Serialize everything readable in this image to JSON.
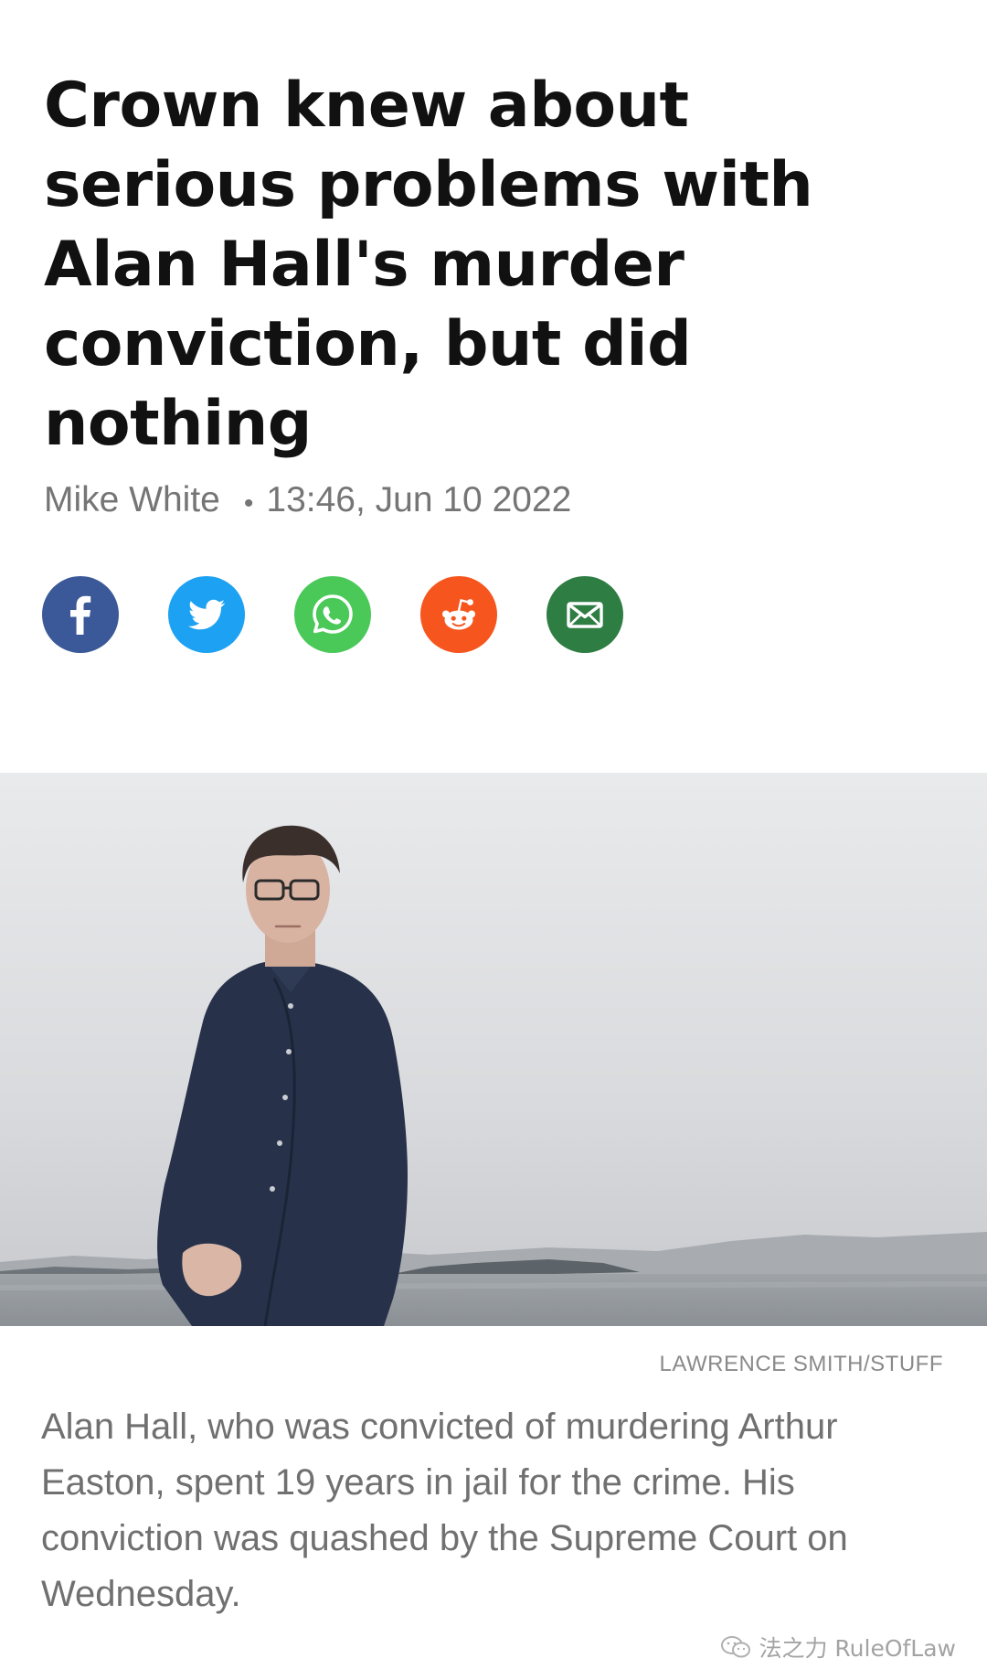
{
  "article": {
    "headline": "Crown knew about serious problems with Alan Hall's murder conviction, but did nothing",
    "author": "Mike White",
    "byline_separator": "•",
    "published": "13:46, Jun 10 2022"
  },
  "share": {
    "buttons": [
      {
        "name": "facebook",
        "icon": "facebook-icon",
        "color": "#3b5998"
      },
      {
        "name": "twitter",
        "icon": "twitter-icon",
        "color": "#1da1f2"
      },
      {
        "name": "whatsapp",
        "icon": "whatsapp-icon",
        "color": "#4ac959"
      },
      {
        "name": "reddit",
        "icon": "reddit-icon",
        "color": "#ff5700"
      },
      {
        "name": "email",
        "icon": "mail-icon",
        "color": "#2e7d43"
      }
    ]
  },
  "photo": {
    "credit": "LAWRENCE SMITH/STUFF",
    "caption": "Alan Hall, who was convicted of murdering Arthur Easton, spent 19 years in jail for the crime. His conviction was quashed by the Supreme Court on Wednesday."
  },
  "watermark": {
    "text": "法之力 RuleOfLaw"
  }
}
